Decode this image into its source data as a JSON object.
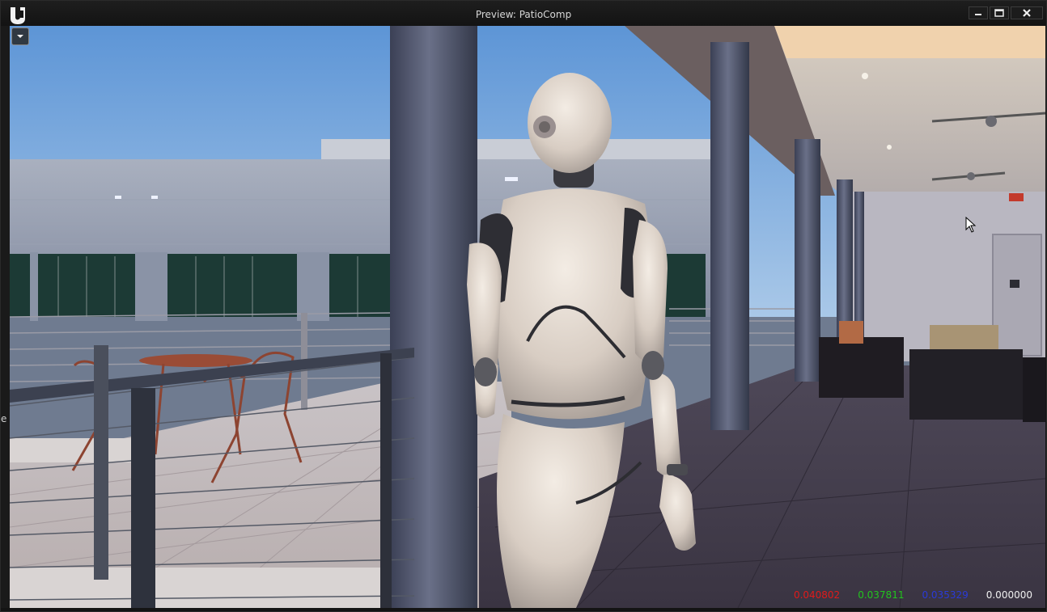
{
  "window": {
    "title": "Preview: PatioComp",
    "controls": [
      "minimize",
      "maximize",
      "close"
    ]
  },
  "viewport": {
    "options_icon": "chevron-down-icon",
    "scene_description_icon": "scene",
    "pixel_values": {
      "r": "0.040802",
      "g": "0.037811",
      "b": "0.035329",
      "a": "0.000000"
    }
  },
  "side_strip": {
    "text": "e"
  },
  "colors": {
    "r_value": "#e01a1a",
    "g_value": "#22c41e",
    "b_value": "#2a3ad8",
    "a_value": "#f0f0f0",
    "title_text": "#d6d6d6"
  }
}
